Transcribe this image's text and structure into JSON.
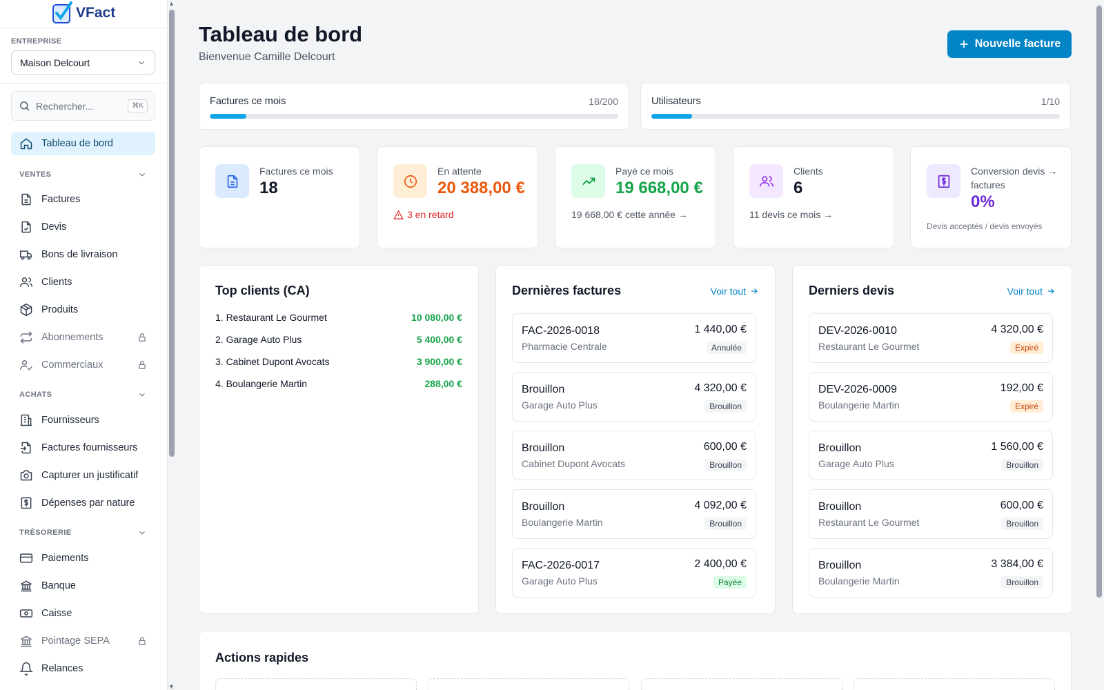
{
  "app": {
    "name": "VFact"
  },
  "sidebar": {
    "company_label": "ENTREPRISE",
    "company_value": "Maison Delcourt",
    "search_placeholder": "Rechercher...",
    "search_shortcut": "⌘K",
    "dashboard": "Tableau de bord",
    "sections": {
      "ventes": "VENTES",
      "achats": "ACHATS",
      "tresorerie": "TRÉSORERIE"
    },
    "items": {
      "factures": "Factures",
      "devis": "Devis",
      "bons": "Bons de livraison",
      "clients": "Clients",
      "produits": "Produits",
      "abonnements": "Abonnements",
      "commerciaux": "Commerciaux",
      "fournisseurs": "Fournisseurs",
      "factures_fournisseurs": "Factures fournisseurs",
      "capturer": "Capturer un justificatif",
      "depenses": "Dépenses par nature",
      "paiements": "Paiements",
      "banque": "Banque",
      "caisse": "Caisse",
      "pointage": "Pointage SEPA",
      "relances": "Relances"
    }
  },
  "header": {
    "title": "Tableau de bord",
    "subtitle": "Bienvenue Camille Delcourt",
    "new_invoice": "Nouvelle facture"
  },
  "usage": [
    {
      "label": "Factures ce mois",
      "value": "18/200",
      "fraction": 0.09
    },
    {
      "label": "Utilisateurs",
      "value": "1/10",
      "fraction": 0.1
    }
  ],
  "stats": {
    "invoices": {
      "label": "Factures ce mois",
      "value": "18"
    },
    "pending": {
      "label": "En attente",
      "value": "20 388,00 €",
      "foot": "3 en retard"
    },
    "paid": {
      "label": "Payé ce mois",
      "value": "19 668,00 €",
      "foot": "19 668,00 € cette année →"
    },
    "clients": {
      "label": "Clients",
      "value": "6",
      "foot": "11 devis ce mois →"
    },
    "conversion": {
      "label": "Conversion devis → factures",
      "value": "0%",
      "foot": "Devis acceptés / devis envoyés"
    }
  },
  "top_clients": {
    "title": "Top clients (CA)",
    "rows": [
      {
        "name": "1. Restaurant Le Gourmet",
        "amount": "10 080,00 €"
      },
      {
        "name": "2. Garage Auto Plus",
        "amount": "5 400,00 €"
      },
      {
        "name": "3. Cabinet Dupont Avocats",
        "amount": "3 900,00 €"
      },
      {
        "name": "4. Boulangerie Martin",
        "amount": "288,00 €"
      }
    ]
  },
  "last_invoices": {
    "title": "Dernières factures",
    "see_all": "Voir tout",
    "rows": [
      {
        "number": "FAC-2026-0018",
        "client": "Pharmacie Centrale",
        "amount": "1 440,00 €",
        "status": "Annulée"
      },
      {
        "number": "Brouillon",
        "client": "Garage Auto Plus",
        "amount": "4 320,00 €",
        "status": "Brouillon"
      },
      {
        "number": "Brouillon",
        "client": "Cabinet Dupont Avocats",
        "amount": "600,00 €",
        "status": "Brouillon"
      },
      {
        "number": "Brouillon",
        "client": "Boulangerie Martin",
        "amount": "4 092,00 €",
        "status": "Brouillon"
      },
      {
        "number": "FAC-2026-0017",
        "client": "Garage Auto Plus",
        "amount": "2 400,00 €",
        "status": "Payée"
      }
    ]
  },
  "last_quotes": {
    "title": "Derniers devis",
    "see_all": "Voir tout",
    "rows": [
      {
        "number": "DEV-2026-0010",
        "client": "Restaurant Le Gourmet",
        "amount": "4 320,00 €",
        "status": "Expiré"
      },
      {
        "number": "DEV-2026-0009",
        "client": "Boulangerie Martin",
        "amount": "192,00 €",
        "status": "Expiré"
      },
      {
        "number": "Brouillon",
        "client": "Garage Auto Plus",
        "amount": "1 560,00 €",
        "status": "Brouillon"
      },
      {
        "number": "Brouillon",
        "client": "Restaurant Le Gourmet",
        "amount": "600,00 €",
        "status": "Brouillon"
      },
      {
        "number": "Brouillon",
        "client": "Boulangerie Martin",
        "amount": "3 384,00 €",
        "status": "Brouillon"
      }
    ]
  },
  "quick_actions": {
    "title": "Actions rapides"
  },
  "colors": {
    "accent": "#0284c7",
    "orange": "#ea580c",
    "green": "#16a34a",
    "purple": "#7c3aed",
    "red": "#dc2626"
  }
}
